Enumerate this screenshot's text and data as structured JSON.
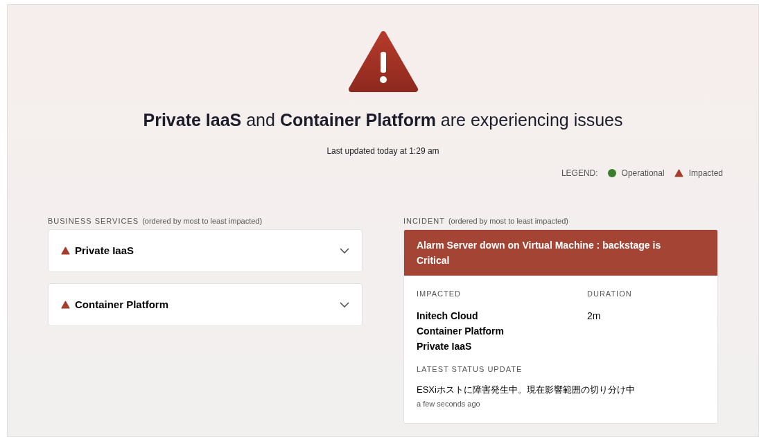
{
  "headline": "**Private IaaS** and **Container Platform** are experiencing issues",
  "last_updated": "Last updated today at 1:29 am",
  "legend": {
    "label": "LEGEND:",
    "items": [
      {
        "kind": "operational",
        "label": "Operational"
      },
      {
        "kind": "impacted",
        "label": "Impacted"
      }
    ]
  },
  "business_services": {
    "title": "BUSINESS SERVICES",
    "subtitle": "(ordered by most to least impacted)",
    "items": [
      {
        "name": "Private IaaS",
        "kind": "impacted",
        "expanded": false
      },
      {
        "name": "Container Platform",
        "kind": "impacted",
        "expanded": false
      }
    ]
  },
  "incident": {
    "title": "INCIDENT",
    "subtitle": "(ordered by most to least impacted)",
    "name": "Alarm Server down on Virtual Machine : backstage is Critical",
    "impacted_label": "IMPACTED",
    "impacted": [
      "Initech Cloud",
      "Container Platform",
      "Private IaaS"
    ],
    "duration_label": "DURATION",
    "duration": "2m",
    "update_label": "LATEST STATUS UPDATE",
    "update": "ESXiホストに障害発生中。現在影響範囲の切り分け中",
    "update_time": "a few seconds ago"
  }
}
